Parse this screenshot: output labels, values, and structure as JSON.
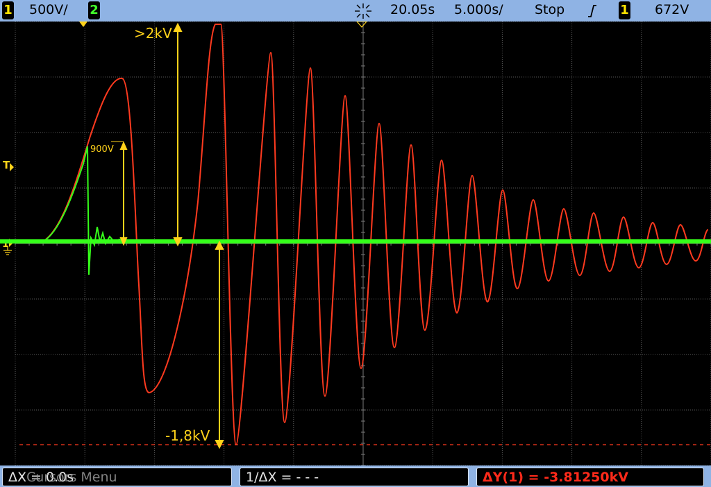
{
  "top_bar": {
    "channel1_number": "1",
    "channel1_scale": "500V/",
    "channel2_number": "2",
    "acquire_icon": "starburst-icon",
    "time_offset": "20.05s",
    "time_scale": "5.000s/",
    "run_state": "Stop",
    "trigger_slope_icon": "rising-edge-icon",
    "trigger_source": "1",
    "trigger_level": "672V"
  },
  "screen_labels": {
    "trigger_level_marker": "T",
    "ground_marker": "1",
    "annotation_top": ">2kV",
    "annotation_900": "900V",
    "annotation_bottom": "-1,8kV"
  },
  "bottom_bar": {
    "softkey1_overlay": "Cursors Menu",
    "softkey1_value": "ΔX = 0.0s",
    "softkey2": "1/ΔX = - - -",
    "softkey3": "ΔY(1) = -3.81250kV"
  },
  "colors": {
    "channel1": "#ff3a1f",
    "channel2": "#35ff1a",
    "annotation": "#ffd21a",
    "grid": "#6e6e6e",
    "bar": "#8fb3e4"
  }
}
